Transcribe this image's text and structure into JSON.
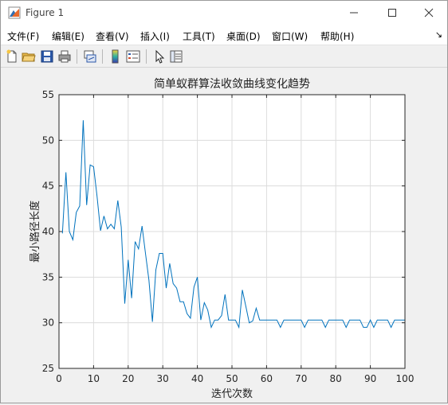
{
  "window": {
    "title": "Figure 1",
    "minimize_icon": "minimize-icon",
    "maximize_icon": "maximize-icon",
    "close_icon": "close-icon"
  },
  "menu": {
    "items": [
      {
        "label": "文件(F)"
      },
      {
        "label": "编辑(E)"
      },
      {
        "label": "查看(V)"
      },
      {
        "label": "插入(I)"
      },
      {
        "label": "工具(T)"
      },
      {
        "label": "桌面(D)"
      },
      {
        "label": "窗口(W)"
      },
      {
        "label": "帮助(H)"
      }
    ],
    "dock_arrow": "↘"
  },
  "toolbar": {
    "icons": [
      "new-figure-icon",
      "open-file-icon",
      "save-icon",
      "print-icon",
      "link-plot-icon",
      "colorbar-icon",
      "legend-icon",
      "pointer-icon",
      "property-inspector-icon"
    ]
  },
  "colors": {
    "line": "#0072bd",
    "grid": "#dcdcdc",
    "axes_bg": "#ffffff",
    "figure_bg": "#f0f0f0"
  },
  "chart_data": {
    "type": "line",
    "title": "简单蚁群算法收敛曲线变化趋势",
    "xlabel": "迭代次数",
    "ylabel": "最小路径长度",
    "xlim": [
      0,
      100
    ],
    "ylim": [
      25,
      55
    ],
    "xticks": [
      0,
      10,
      20,
      30,
      40,
      50,
      60,
      70,
      80,
      90,
      100
    ],
    "yticks": [
      25,
      30,
      35,
      40,
      45,
      50,
      55
    ],
    "grid": true,
    "legend": null,
    "series": [
      {
        "x": [
          1,
          2,
          3,
          4,
          5,
          6,
          7,
          8,
          9,
          10,
          11,
          12,
          13,
          14,
          15,
          16,
          17,
          18,
          19,
          20,
          21,
          22,
          23,
          24,
          25,
          26,
          27,
          28,
          29,
          30,
          31,
          32,
          33,
          34,
          35,
          36,
          37,
          38,
          39,
          40,
          41,
          42,
          43,
          44,
          45,
          46,
          47,
          48,
          49,
          50,
          51,
          52,
          53,
          54,
          55,
          56,
          57,
          58,
          59,
          60,
          61,
          62,
          63,
          64,
          65,
          66,
          67,
          68,
          69,
          70,
          71,
          72,
          73,
          74,
          75,
          76,
          77,
          78,
          79,
          80,
          81,
          82,
          83,
          84,
          85,
          86,
          87,
          88,
          89,
          90,
          91,
          92,
          93,
          94,
          95,
          96,
          97,
          98,
          99,
          100
        ],
        "y": [
          39.8,
          46.5,
          40.0,
          39.1,
          42.1,
          42.8,
          52.2,
          42.9,
          47.3,
          47.1,
          43.9,
          40.1,
          41.7,
          40.3,
          40.8,
          40.3,
          43.4,
          40.5,
          32.1,
          36.9,
          32.7,
          38.9,
          38.1,
          40.6,
          37.6,
          34.7,
          30.1,
          35.8,
          37.6,
          37.6,
          33.8,
          36.5,
          34.3,
          33.8,
          32.3,
          32.3,
          31.0,
          30.5,
          33.9,
          35.0,
          30.3,
          32.2,
          31.4,
          29.5,
          30.3,
          30.3,
          30.8,
          33.1,
          30.3,
          30.3,
          30.3,
          29.5,
          33.6,
          31.8,
          30.0,
          30.2,
          31.6,
          30.3,
          30.3,
          30.3,
          30.3,
          30.3,
          30.3,
          29.5,
          30.3,
          30.3,
          30.3,
          30.3,
          30.3,
          30.3,
          29.5,
          30.3,
          30.3,
          30.3,
          30.3,
          30.3,
          29.5,
          30.3,
          30.3,
          30.3,
          30.3,
          30.3,
          29.5,
          30.3,
          30.3,
          30.3,
          30.3,
          29.5,
          29.5,
          30.3,
          29.5,
          30.3,
          30.3,
          30.3,
          30.3,
          29.5,
          30.3,
          30.3,
          30.3,
          30.3
        ]
      }
    ]
  }
}
